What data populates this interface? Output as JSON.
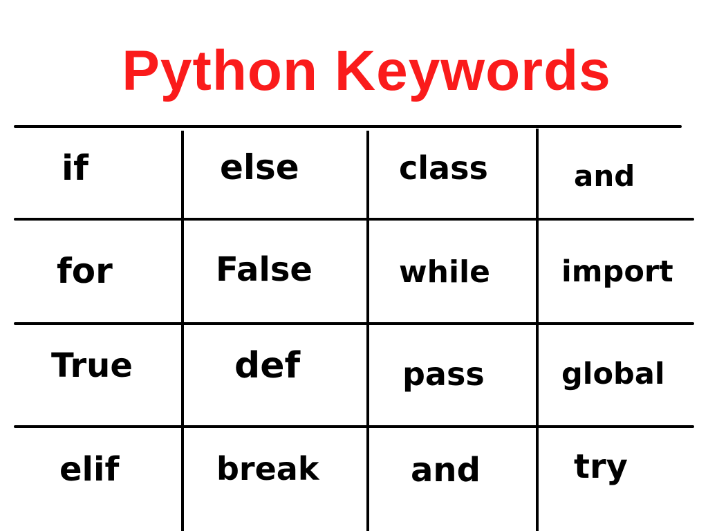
{
  "title": "Python Keywords",
  "colors": {
    "title": "#fa1b1b",
    "grid": "#000000",
    "text": "#000000",
    "background": "#ffffff"
  },
  "grid": {
    "rows": [
      [
        "if",
        "else",
        "class",
        "and"
      ],
      [
        "for",
        "False",
        "while",
        "import"
      ],
      [
        "True",
        "def",
        "pass",
        "global"
      ],
      [
        "elif",
        "break",
        "and",
        "try"
      ]
    ]
  }
}
